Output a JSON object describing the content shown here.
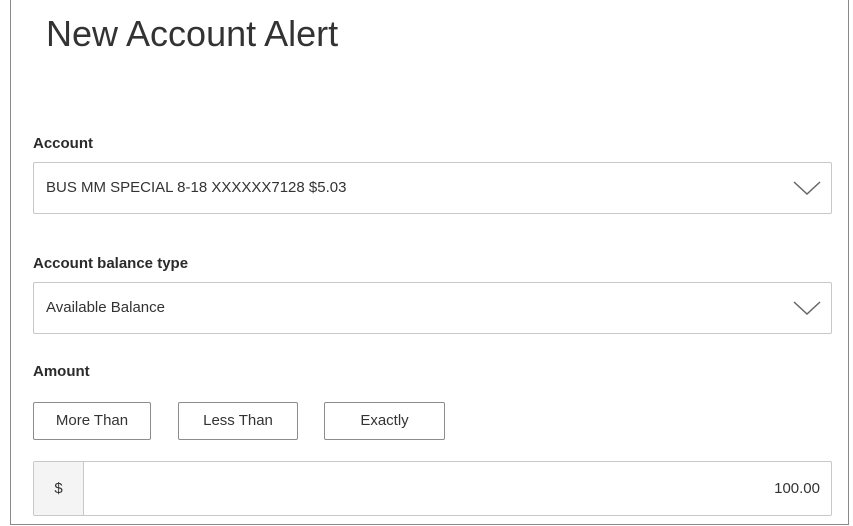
{
  "page": {
    "title": "New Account Alert"
  },
  "account": {
    "label": "Account",
    "selected": "BUS MM SPECIAL 8-18 XXXXXX7128 $5.03",
    "icon": "chevron-down-icon"
  },
  "balance_type": {
    "label": "Account balance type",
    "selected": "Available Balance",
    "icon": "chevron-down-icon"
  },
  "amount": {
    "label": "Amount",
    "options": [
      "More Than",
      "Less Than",
      "Exactly"
    ],
    "currency_symbol": "$",
    "value": "100.00"
  },
  "colors": {
    "text": "#333333",
    "border": "#c8c8c8",
    "button_border": "#8c8c8c",
    "prefix_bg": "#f4f4f4"
  }
}
